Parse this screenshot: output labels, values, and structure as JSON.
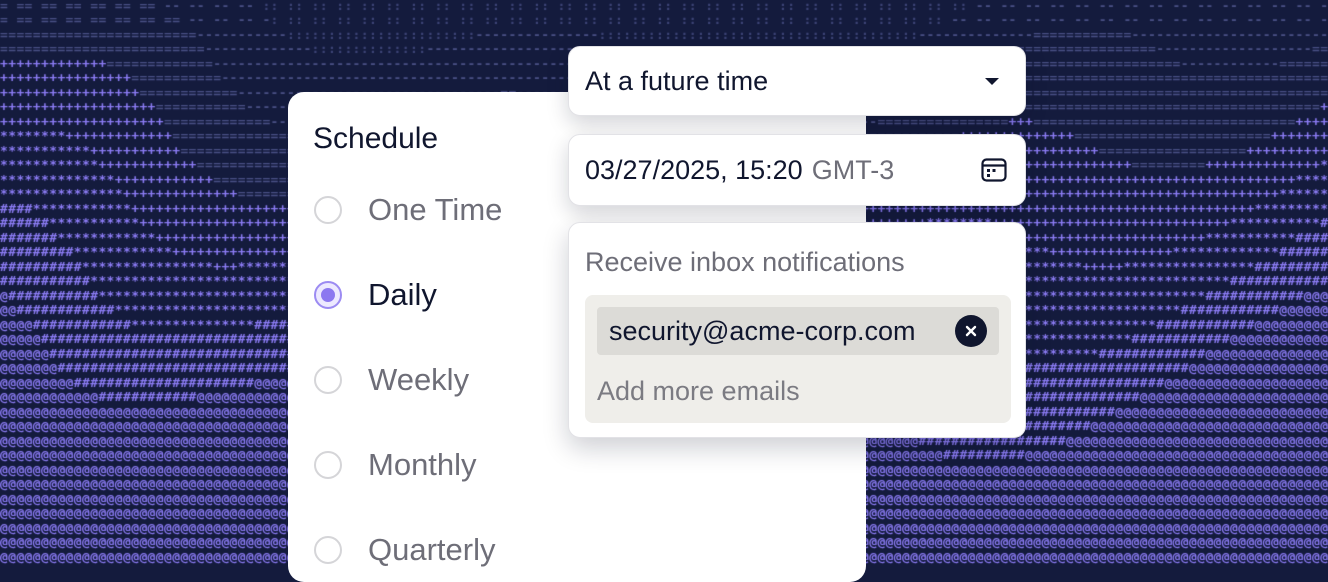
{
  "colors": {
    "background": "#141b3d",
    "pattern_dim": "#4a5186",
    "pattern_bright": "#8c7cf5",
    "accent": "#8c78f0",
    "text_primary": "#10162e",
    "text_muted": "#6e6e78"
  },
  "background_pattern": {
    "glyphs": [
      ":",
      "-",
      "=",
      "+",
      "*",
      "#",
      "@"
    ]
  },
  "schedule": {
    "title": "Schedule",
    "options": [
      {
        "label": "One Time",
        "selected": false
      },
      {
        "label": "Daily",
        "selected": true
      },
      {
        "label": "Weekly",
        "selected": false
      },
      {
        "label": "Monthly",
        "selected": false
      },
      {
        "label": "Quarterly",
        "selected": false
      }
    ]
  },
  "timing": {
    "selected": "At a future time",
    "icon": "caret-down-icon"
  },
  "datetime": {
    "value": "03/27/2025, 15:20",
    "timezone": "GMT-3",
    "icon": "calendar-icon"
  },
  "notifications": {
    "label": "Receive inbox notifications",
    "emails": [
      "security@acme-corp.com"
    ],
    "remove_icon": "close-icon",
    "placeholder": "Add more emails"
  }
}
